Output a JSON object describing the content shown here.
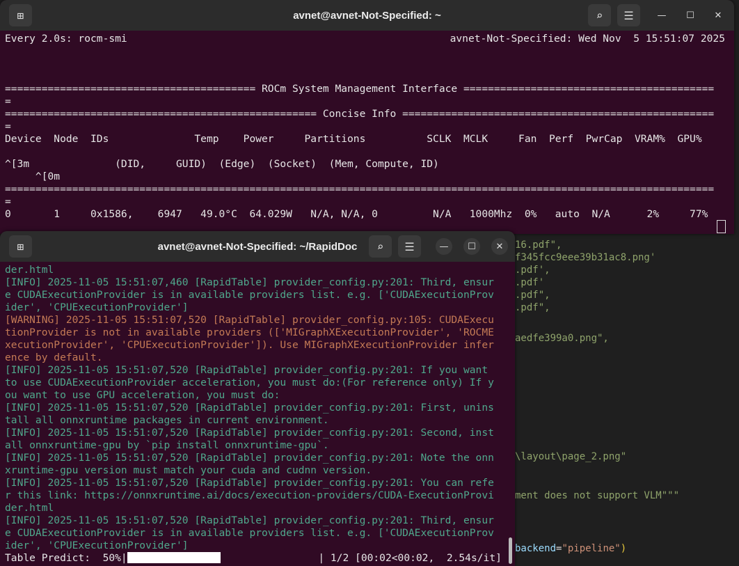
{
  "editor_bg_lines": [
    "16.pdf\",",
    "f345fcc9eee39b31ac8.png'",
    ".pdf',",
    ".pdf'",
    ".pdf\",",
    ".pdf\",",
    "aedfe399a0.png\",",
    "\\layout\\page_2.png\"",
    "ment does not support VLM\"\"\"",
    "backend",
    "=",
    "\"pipeline\"",
    ")"
  ],
  "top_window": {
    "title": "avnet@avnet-Not-Specified: ~",
    "watch_left": "Every 2.0s: rocm-smi",
    "watch_right": "avnet-Not-Specified: Wed Nov  5 15:51:07 2025",
    "lines": [
      "",
      "",
      "",
      "========================================= ROCm System Management Interface =========================================",
      "=",
      "=================================================== Concise Info ===================================================",
      "=",
      "Device  Node  IDs              Temp    Power     Partitions          SCLK  MCLK     Fan  Perf  PwrCap  VRAM%  GPU%",
      "",
      "^[3m              (DID,     GUID)  (Edge)  (Socket)  (Mem, Compute, ID)",
      "     ^[0m",
      "====================================================================================================================",
      "=",
      "0       1     0x1586,    6947   49.0°C  64.029W   N/A, N/A, 0         N/A   1000Mhz  0%   auto  N/A      2%     77%"
    ]
  },
  "bottom_window": {
    "title": "avnet@avnet-Not-Specified: ~/RapidDoc",
    "lines": [
      {
        "t": "info",
        "text": "der.html"
      },
      {
        "t": "info",
        "text": "[INFO] 2025-11-05 15:51:07,460 [RapidTable] provider_config.py:201: Third, ensur"
      },
      {
        "t": "info",
        "text": "e CUDAExecutionProvider is in available providers list. e.g. ['CUDAExecutionProv"
      },
      {
        "t": "info",
        "text": "ider', 'CPUExecutionProvider']"
      },
      {
        "t": "warn",
        "text": "[WARNING] 2025-11-05 15:51:07,520 [RapidTable] provider_config.py:105: CUDAExecu"
      },
      {
        "t": "warn",
        "text": "tionProvider is not in available providers (['MIGraphXExecutionProvider', 'ROCME"
      },
      {
        "t": "warn",
        "text": "xecutionProvider', 'CPUExecutionProvider']). Use MIGraphXExecutionProvider infer"
      },
      {
        "t": "warn",
        "text": "ence by default."
      },
      {
        "t": "info",
        "text": "[INFO] 2025-11-05 15:51:07,520 [RapidTable] provider_config.py:201: If you want"
      },
      {
        "t": "info",
        "text": "to use CUDAExecutionProvider acceleration, you must do:(For reference only) If y"
      },
      {
        "t": "info",
        "text": "ou want to use GPU acceleration, you must do:"
      },
      {
        "t": "info",
        "text": "[INFO] 2025-11-05 15:51:07,520 [RapidTable] provider_config.py:201: First, unins"
      },
      {
        "t": "info",
        "text": "tall all onnxruntime packages in current environment."
      },
      {
        "t": "info",
        "text": "[INFO] 2025-11-05 15:51:07,520 [RapidTable] provider_config.py:201: Second, inst"
      },
      {
        "t": "info",
        "text": "all onnxruntime-gpu by `pip install onnxruntime-gpu`."
      },
      {
        "t": "info",
        "text": "[INFO] 2025-11-05 15:51:07,520 [RapidTable] provider_config.py:201: Note the onn"
      },
      {
        "t": "info",
        "text": "xruntime-gpu version must match your cuda and cudnn version."
      },
      {
        "t": "info",
        "text": "[INFO] 2025-11-05 15:51:07,520 [RapidTable] provider_config.py:201: You can refe"
      },
      {
        "t": "info",
        "text": "r this link: https://onnxruntime.ai/docs/execution-providers/CUDA-ExecutionProvi"
      },
      {
        "t": "info",
        "text": "der.html"
      },
      {
        "t": "info",
        "text": "[INFO] 2025-11-05 15:51:07,520 [RapidTable] provider_config.py:201: Third, ensur"
      },
      {
        "t": "info",
        "text": "e CUDAExecutionProvider is in available providers list. e.g. ['CUDAExecutionProv"
      },
      {
        "t": "info",
        "text": "ider', 'CPUExecutionProvider']"
      }
    ],
    "progress": {
      "label": "Table Predict:  50%|",
      "percent": 50,
      "suffix": "                | 1/2 [00:02<00:02,  2.54s/it]"
    }
  },
  "colors": {
    "terminal_bg": "#300a24",
    "info": "#4fa88c",
    "warning": "#c47a55"
  }
}
